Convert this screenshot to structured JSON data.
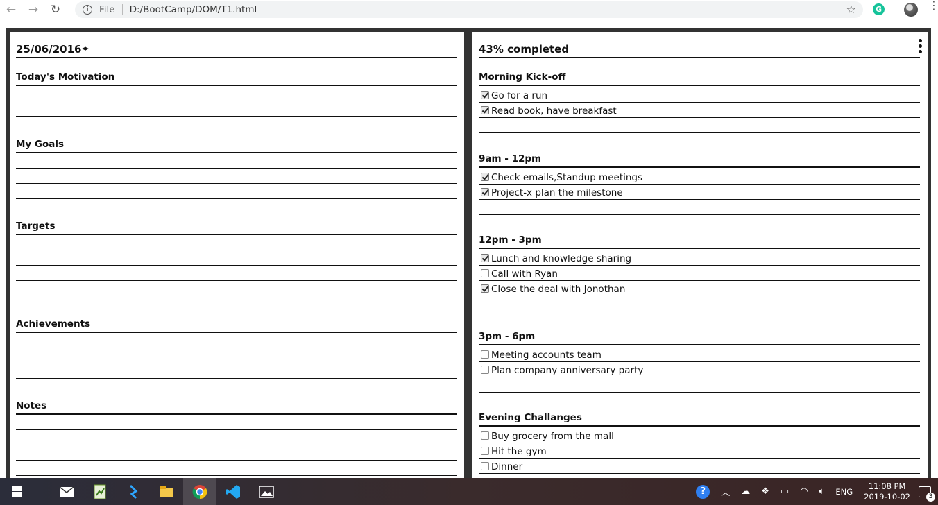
{
  "browser": {
    "scheme_label": "File",
    "url": "D:/BootCamp/DOM/T1.html",
    "extension_label": "G"
  },
  "left": {
    "date": "25/06/2016",
    "date_arrows": "◂▸",
    "sections": [
      {
        "title": "Today's Motivation",
        "lines": 2
      },
      {
        "title": "My Goals",
        "lines": 3
      },
      {
        "title": "Targets",
        "lines": 4
      },
      {
        "title": "Achievements",
        "lines": 3
      },
      {
        "title": "Notes",
        "lines": 4
      }
    ]
  },
  "right": {
    "progress_text": "43% completed",
    "progress_value": 0.43,
    "sections": [
      {
        "title": "Morning Kick-off",
        "tasks": [
          {
            "label": "Go for a run",
            "checked": true
          },
          {
            "label": "Read book, have breakfast",
            "checked": true
          }
        ]
      },
      {
        "title": "9am - 12pm",
        "tasks": [
          {
            "label": "Check emails,Standup meetings",
            "checked": true
          },
          {
            "label": "Project-x plan the milestone",
            "checked": true
          }
        ]
      },
      {
        "title": "12pm - 3pm",
        "tasks": [
          {
            "label": "Lunch and knowledge sharing",
            "checked": true
          },
          {
            "label": "Call with Ryan",
            "checked": false
          },
          {
            "label": "Close the deal with Jonothan",
            "checked": true
          }
        ]
      },
      {
        "title": "3pm - 6pm",
        "tasks": [
          {
            "label": "Meeting accounts team",
            "checked": false
          },
          {
            "label": "Plan company anniversary party",
            "checked": false
          }
        ]
      },
      {
        "title": "Evening Challanges",
        "tasks": [
          {
            "label": "Buy grocery from the mall",
            "checked": false
          },
          {
            "label": "Hit the gym",
            "checked": false
          },
          {
            "label": "Dinner",
            "checked": false
          }
        ]
      }
    ]
  },
  "taskbar": {
    "language": "ENG",
    "time": "11:08 PM",
    "date": "2019-10-02",
    "notification_count": "3"
  }
}
